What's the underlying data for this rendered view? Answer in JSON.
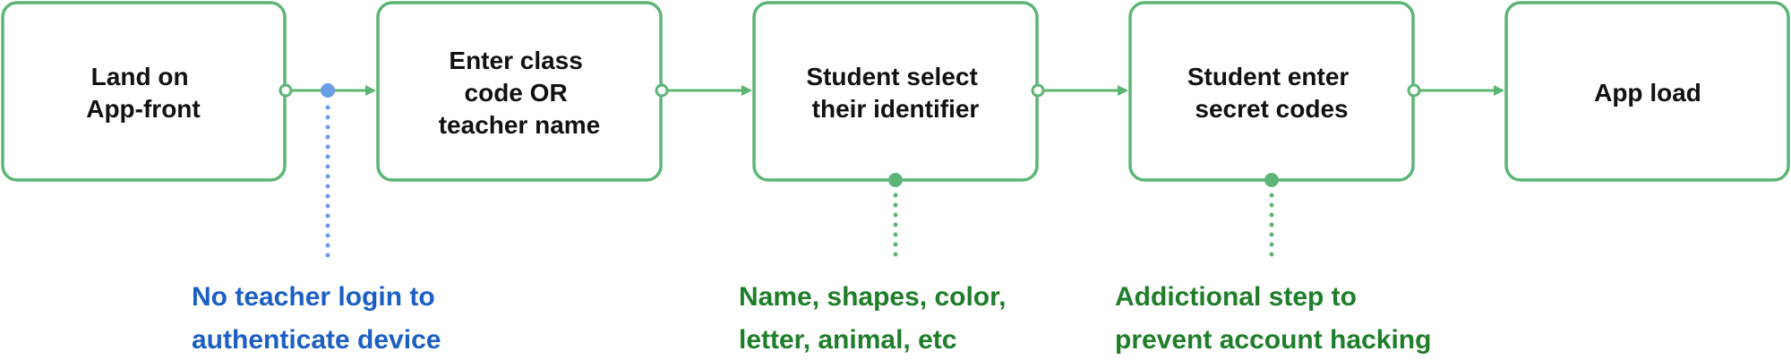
{
  "steps": [
    {
      "lines": [
        "Land on",
        "App-front"
      ]
    },
    {
      "lines": [
        "Enter class",
        "code OR",
        "teacher name"
      ]
    },
    {
      "lines": [
        "Student select",
        "their identifier"
      ]
    },
    {
      "lines": [
        "Student enter",
        "secret codes"
      ]
    },
    {
      "lines": [
        "App load"
      ]
    }
  ],
  "notes": [
    {
      "lines": [
        "No teacher login to",
        "authenticate device"
      ]
    },
    {
      "lines": [
        "Name, shapes, color,",
        "letter, animal, etc"
      ]
    },
    {
      "lines": [
        "Addictional step to",
        "prevent account hacking"
      ]
    }
  ],
  "colors": {
    "flow_green": "#5cb574",
    "note_blue_text": "#1c5fc4",
    "note_blue_dot": "#6b9ce6",
    "note_green_text": "#1e7e2a",
    "box_text": "#111111"
  }
}
